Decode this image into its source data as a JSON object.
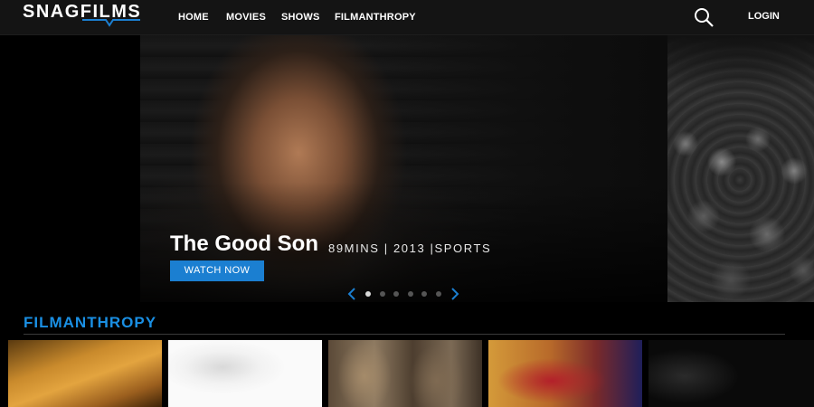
{
  "brand": {
    "name": "SNAGFILMS"
  },
  "nav": {
    "items": [
      "HOME",
      "MOVIES",
      "SHOWS",
      "FILMANTHROPY"
    ],
    "login": "LOGIN"
  },
  "hero": {
    "title": "The Good Son",
    "meta": "89MINS | 2013 |SPORTS",
    "cta": "WATCH NOW",
    "slide_count": 6,
    "active_slide": 1
  },
  "section": {
    "title": "FILMANTHROPY"
  },
  "colors": {
    "accent": "#1b7fd1",
    "section_title": "#1a8fe3",
    "header_bg": "#141414"
  },
  "icons": [
    "search-icon",
    "chevron-left-icon",
    "chevron-right-icon",
    "logo-swoosh-icon"
  ]
}
